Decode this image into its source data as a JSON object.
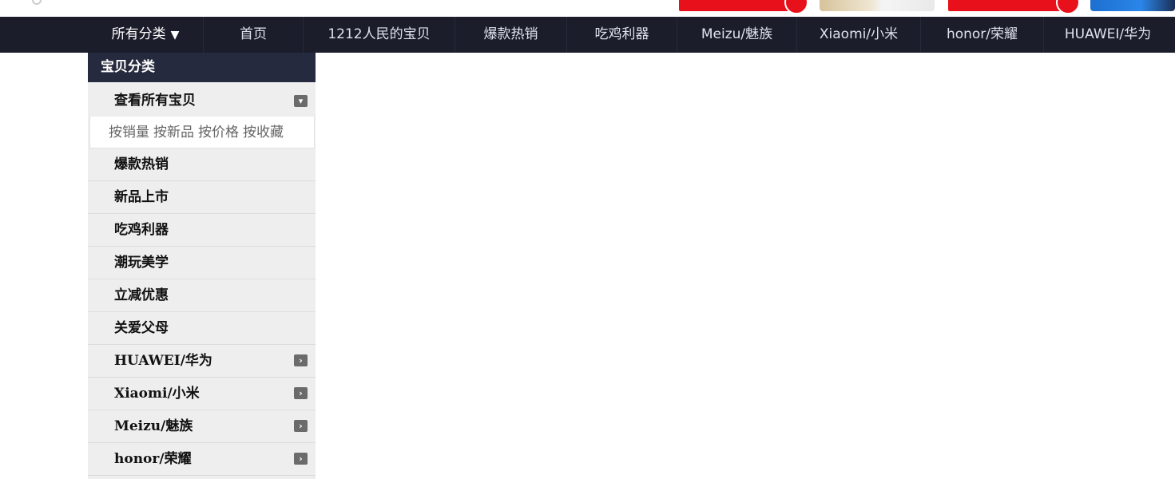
{
  "nav": {
    "items": [
      {
        "label": "所有分类",
        "caret": "▼"
      },
      {
        "label": "首页"
      },
      {
        "label": "1212人民的宝贝"
      },
      {
        "label": "爆款热销"
      },
      {
        "label": "吃鸡利器"
      },
      {
        "label": "Meizu/魅族"
      },
      {
        "label": "Xiaomi/小米"
      },
      {
        "label": "honor/荣耀"
      },
      {
        "label": "HUAWEI/华为"
      }
    ]
  },
  "sidebar": {
    "header": "宝贝分类",
    "view_all": "查看所有宝贝",
    "sort_links": [
      "按销量",
      "按新品",
      "按价格",
      "按收藏"
    ],
    "categories": [
      {
        "label": "爆款热销"
      },
      {
        "label": "新品上市"
      },
      {
        "label": "吃鸡利器"
      },
      {
        "label": "潮玩美学"
      },
      {
        "label": "立减优惠"
      },
      {
        "label": "关爱父母"
      },
      {
        "label": "HUAWEI/华为",
        "icon": "chevron-right-icon"
      },
      {
        "label": "Xiaomi/小米",
        "icon": "chevron-right-icon"
      },
      {
        "label": "Meizu/魅族",
        "icon": "chevron-right-icon"
      },
      {
        "label": "honor/荣耀",
        "icon": "chevron-right-icon"
      }
    ]
  },
  "colors": {
    "nav_bg": "#1b1d2b",
    "panel_header_bg": "#262a3e",
    "panel_bg": "#eeeeee",
    "promo_red": "#e8101a"
  }
}
